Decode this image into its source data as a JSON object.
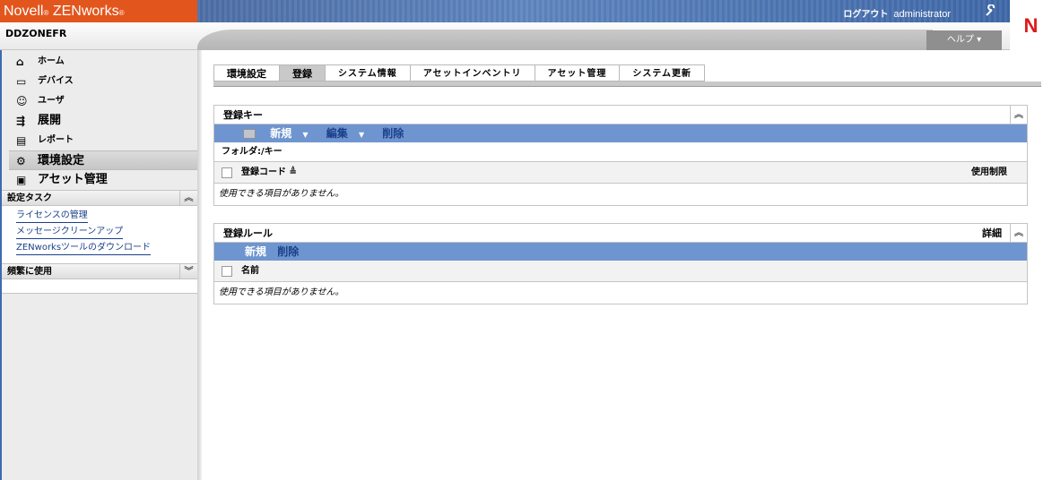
{
  "header": {
    "brand": "Novell",
    "brand_reg": "®",
    "product": " ZENworks",
    "product_reg": "®",
    "logout_label": "ログアウト",
    "user": "administrator",
    "zone": "DDZONEFR",
    "help_label": "ヘルプ ▾"
  },
  "sidebar": {
    "nav": [
      {
        "label": "ホーム",
        "icon": "home-icon"
      },
      {
        "label": "デバイス",
        "icon": "device-icon"
      },
      {
        "label": "ユーザ",
        "icon": "user-icon"
      },
      {
        "label": "展開",
        "icon": "deploy-icon"
      },
      {
        "label": "レポート",
        "icon": "report-icon"
      },
      {
        "label": "環境設定",
        "icon": "gear-icon"
      },
      {
        "label": "アセット管理",
        "icon": "asset-icon"
      }
    ],
    "tasks_title": "設定タスク",
    "tasks": [
      "ライセンスの管理",
      "メッセージクリーンアップ",
      "ZENworksツールのダウンロード"
    ],
    "frequent_title": "頻繁に使用"
  },
  "tabs": [
    "環境設定",
    "登録",
    "システム情報",
    "アセットインベントリ",
    "アセット管理",
    "システム更新"
  ],
  "registration_keys": {
    "title": "登録キー",
    "toolbar": {
      "new": "新規",
      "edit": "編集",
      "delete": "削除"
    },
    "folder": "フォルダ:/キー",
    "col_code": "登録コード",
    "col_limit": "使用制限",
    "empty": "使用できる項目がありません。"
  },
  "registration_rules": {
    "title": "登録ルール",
    "details": "詳細",
    "toolbar": {
      "new": "新規",
      "delete": "削除"
    },
    "col_name": "名前",
    "empty": "使用できる項目がありません。"
  }
}
